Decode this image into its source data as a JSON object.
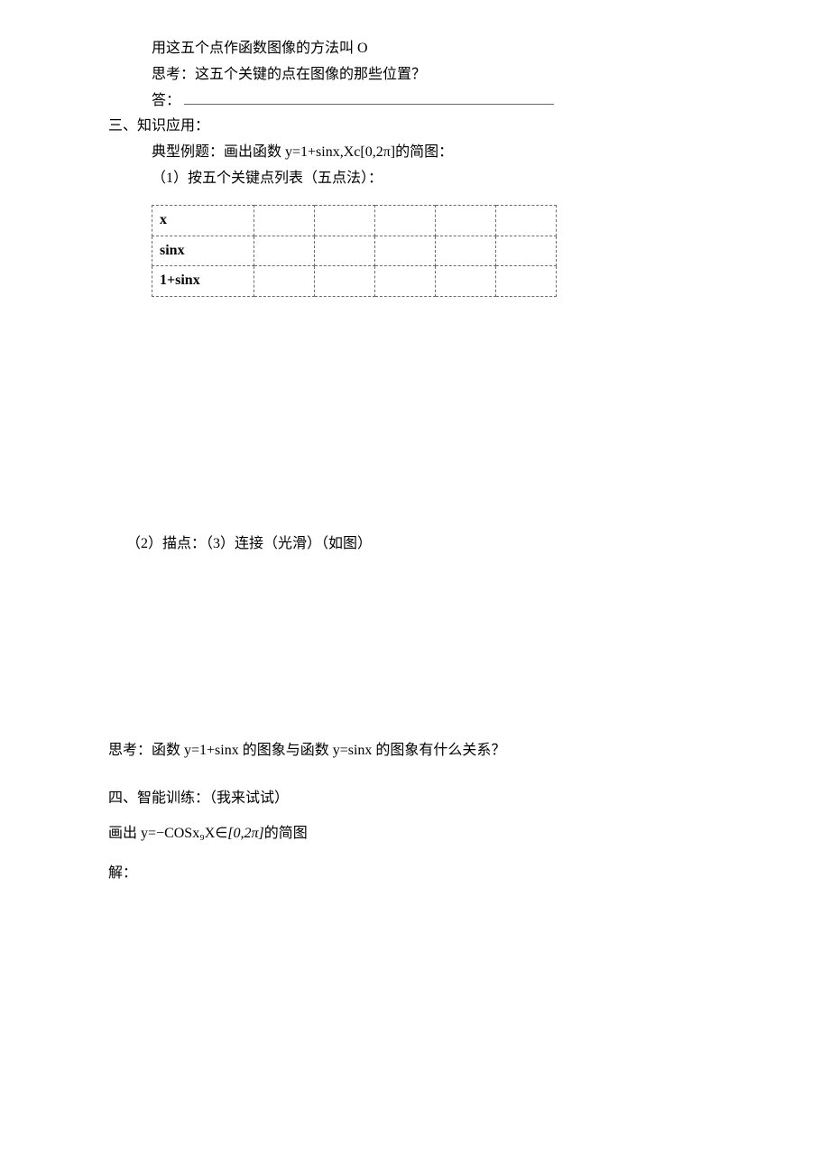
{
  "intro": {
    "line1": "用这五个点作函数图像的方法叫 O",
    "line2": "思考：这五个关键的点在图像的那些位置？",
    "answer_label": "答："
  },
  "section3": {
    "title": "三、知识应用：",
    "example": "典型例题：画出函数 y=1+sinx,Xc[0,2π]的简图：",
    "step1": "（1）按五个关键点列表（五点法）：",
    "table": {
      "rows": [
        "x",
        "sinx",
        "1+sinx"
      ]
    },
    "step23": "（2）描点：（3）连接（光滑）（如图）",
    "think": "思考：函数 y=1+sinx 的图象与函数 y=sinx 的图象有什么关系？"
  },
  "section4": {
    "title_prefix": "四、智能训练：（我来试试）",
    "draw_prefix": "画出 ",
    "draw_func": "y=−COSx₉X∈",
    "draw_domain": "[0,2π]",
    "draw_suffix": "的简图",
    "solve": "解："
  }
}
